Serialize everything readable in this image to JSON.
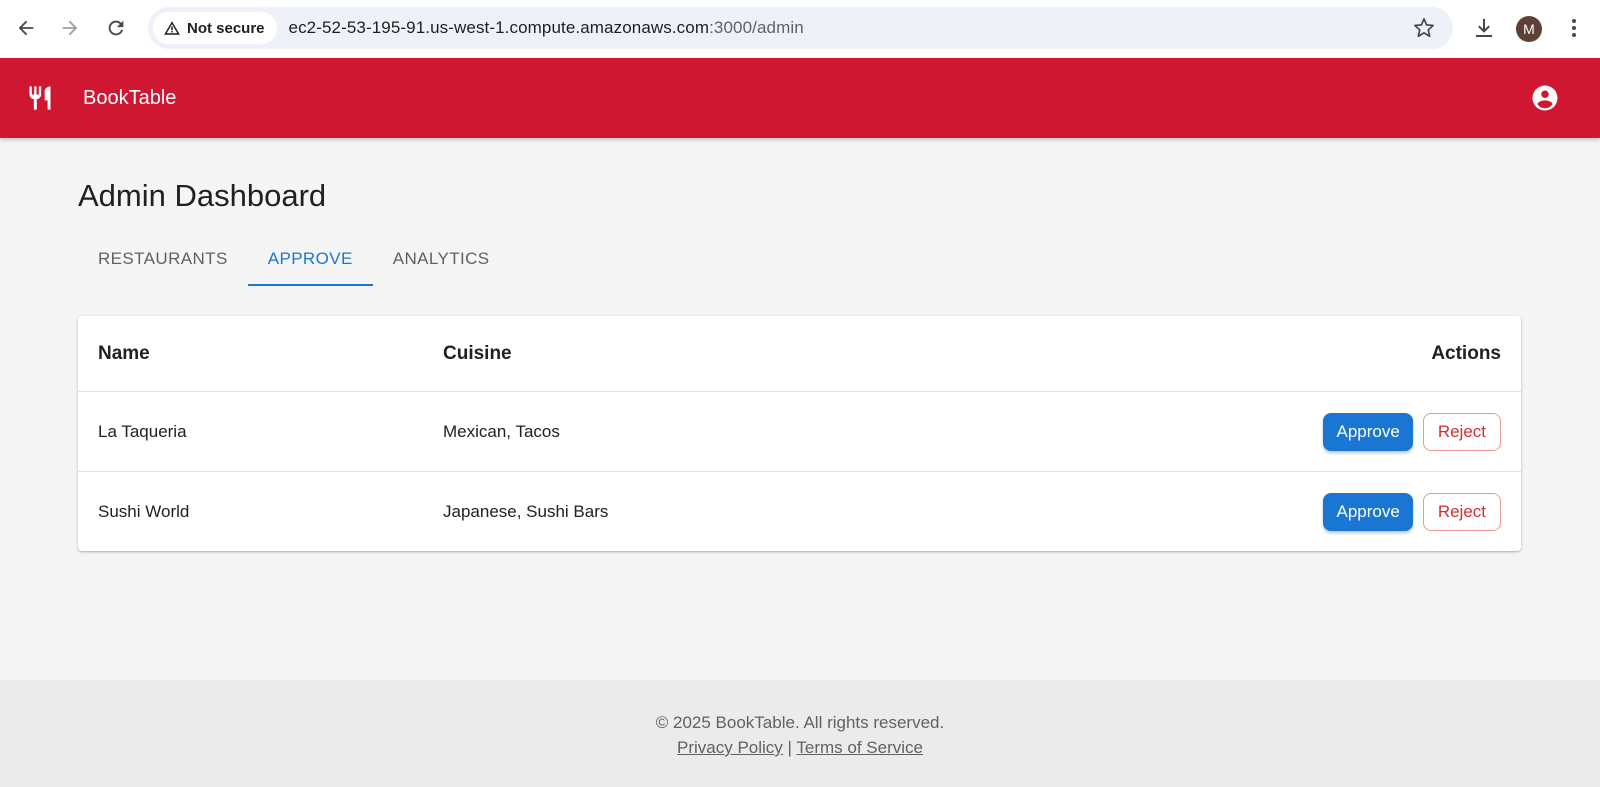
{
  "browser": {
    "security_label": "Not secure",
    "url_host": "ec2-52-53-195-91.us-west-1.compute.amazonaws.com",
    "url_path": ":3000/admin",
    "profile_initial": "M"
  },
  "appbar": {
    "brand": "BookTable",
    "color": "#d01731"
  },
  "page": {
    "title": "Admin Dashboard",
    "tabs": [
      {
        "label": "Restaurants",
        "active": false
      },
      {
        "label": "Approve",
        "active": true
      },
      {
        "label": "Analytics",
        "active": false
      }
    ]
  },
  "table": {
    "headers": {
      "name": "Name",
      "cuisine": "Cuisine",
      "actions": "Actions"
    },
    "rows": [
      {
        "name": "La Taqueria",
        "cuisine": "Mexican, Tacos",
        "approve_label": "Approve",
        "reject_label": "Reject"
      },
      {
        "name": "Sushi World",
        "cuisine": "Japanese, Sushi Bars",
        "approve_label": "Approve",
        "reject_label": "Reject"
      }
    ]
  },
  "footer": {
    "copyright": "© 2025 BookTable. All rights reserved.",
    "privacy": "Privacy Policy",
    "separator": "|",
    "terms": "Terms of Service"
  },
  "colors": {
    "primary": "#1976d2",
    "danger": "#d32f2f",
    "brand": "#d01731"
  }
}
